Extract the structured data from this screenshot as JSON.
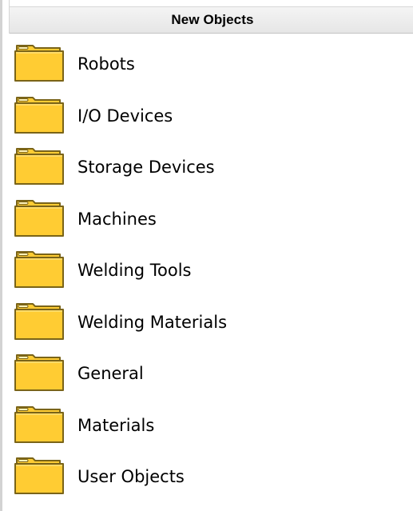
{
  "panel": {
    "title": "New Objects"
  },
  "items": [
    {
      "label": "Robots",
      "icon": "folder-icon"
    },
    {
      "label": "I/O Devices",
      "icon": "folder-icon"
    },
    {
      "label": "Storage Devices",
      "icon": "folder-icon"
    },
    {
      "label": "Machines",
      "icon": "folder-icon"
    },
    {
      "label": "Welding Tools",
      "icon": "folder-icon"
    },
    {
      "label": "Welding Materials",
      "icon": "folder-icon"
    },
    {
      "label": "General",
      "icon": "folder-icon"
    },
    {
      "label": "Materials",
      "icon": "folder-icon"
    },
    {
      "label": "User Objects",
      "icon": "folder-icon"
    }
  ],
  "colors": {
    "folder_fill": "#ffcc33",
    "folder_outline": "#7a6418",
    "header_bg": "#ececec"
  }
}
